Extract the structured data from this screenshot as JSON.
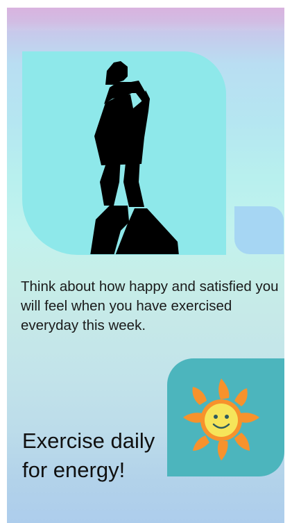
{
  "content": {
    "motivation_text": "Think about how happy and satisfied you will feel when you have exercised everyday this week.",
    "tagline_line1": "Exercise daily",
    "tagline_line2": "for energy!"
  },
  "icons": {
    "hero": "standing-person-on-rock-silhouette",
    "sun": "smiling-sun-icon"
  },
  "colors": {
    "hero_card": "#8ee8ea",
    "small_card": "#a6d6f3",
    "sun_card": "#4cb5bd",
    "sun_rays": "#f7922c",
    "sun_face": "#f6e55a",
    "header_band": "#d9b3df"
  }
}
